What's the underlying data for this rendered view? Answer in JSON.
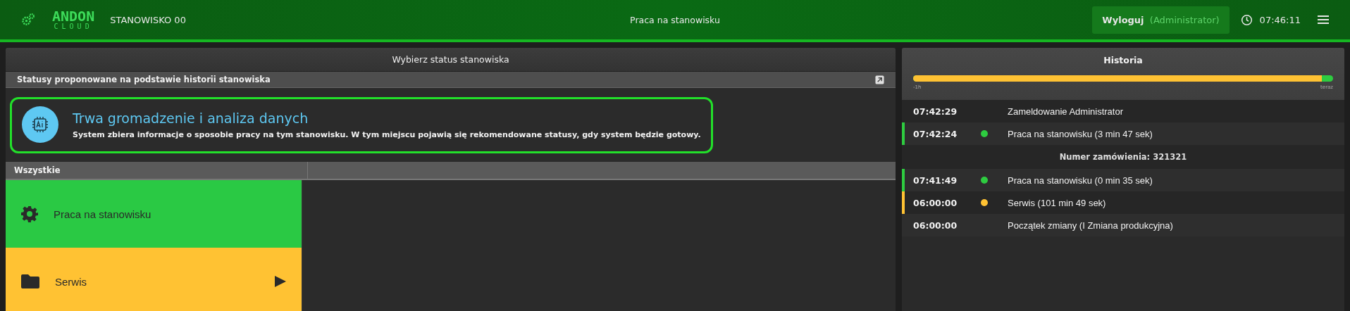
{
  "header": {
    "logo": {
      "top": "ANDON",
      "bottom": "CLOUD"
    },
    "station": "STANOWISKO 00",
    "status": "Praca na stanowisku",
    "logout": {
      "label": "Wyloguj",
      "user": "(Administrator)"
    },
    "time": "07:46:11"
  },
  "status_panel": {
    "title": "Wybierz status stanowiska",
    "suggested_header": "Statusy proponowane na podstawie historii stanowiska",
    "notice": {
      "title": "Trwa gromadzenie i analiza danych",
      "text": "System zbiera informacje o sposobie pracy na tym stanowisku. W tym miejscu pojawią się rekomendowane statusy, gdy system będzie gotowy."
    },
    "category_header": "Wszystkie",
    "statuses": [
      {
        "label": "Praca na stanowisku",
        "kind": "work",
        "color": "#2ac944",
        "has_submenu": false
      },
      {
        "label": "Serwis",
        "kind": "folder",
        "color": "#ffc233",
        "has_submenu": true
      }
    ]
  },
  "history": {
    "title": "Historia",
    "timeline": {
      "start": "-1h",
      "end": "teraz",
      "level": 0.973
    },
    "rows": [
      {
        "kind": "event",
        "time": "07:42:29",
        "text": "Zameldowanie Administrator"
      },
      {
        "kind": "status",
        "time": "07:42:24",
        "text": "Praca na stanowisku (3 min 47 sek)",
        "color": "#2ecc40"
      },
      {
        "kind": "order",
        "text": "Numer zamówienia: 321321"
      },
      {
        "kind": "status",
        "time": "07:41:49",
        "text": "Praca na stanowisku (0 min 35 sek)",
        "color": "#2ecc40"
      },
      {
        "kind": "status",
        "time": "06:00:00",
        "text": "Serwis (101 min 49 sek)",
        "color": "#ffc233"
      },
      {
        "kind": "event",
        "time": "06:00:00",
        "text": "Początek zmiany (I Zmiana produkcyjna)"
      }
    ]
  }
}
